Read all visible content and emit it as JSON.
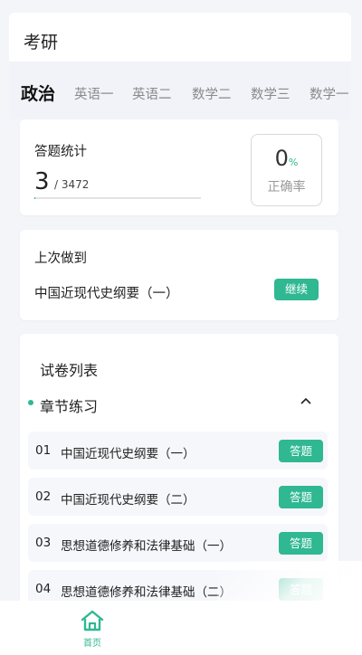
{
  "header": {
    "title": "考研"
  },
  "tabs": [
    {
      "label": "政治",
      "active": true
    },
    {
      "label": "英语一"
    },
    {
      "label": "英语二"
    },
    {
      "label": "数学二"
    },
    {
      "label": "数学三"
    },
    {
      "label": "数学一"
    }
  ],
  "stats": {
    "label": "答题统计",
    "answered": "3",
    "total": "/ 3472",
    "progress_fraction": 0.0009,
    "correct_rate": "0",
    "correct_rate_unit": "%",
    "correct_rate_label": "正确率"
  },
  "last_done": {
    "label": "上次做到",
    "chapter": "中国近现代史纲要（一）",
    "continue_label": "继续"
  },
  "paper_list": {
    "title": "试卷列表",
    "section_label": "章节练习",
    "items": [
      {
        "num": "01",
        "name": "中国近现代史纲要（一）",
        "action": "答题"
      },
      {
        "num": "02",
        "name": "中国近现代史纲要（二）",
        "action": "答题"
      },
      {
        "num": "03",
        "name": "思想道德修养和法律基础（一）",
        "action": "答题"
      },
      {
        "num": "04",
        "name": "思想道德修养和法律基础（二）",
        "action": "答题"
      }
    ]
  },
  "bottom_nav": {
    "home_label": "首页"
  },
  "colors": {
    "accent": "#2fb892",
    "icon": "home-icon"
  }
}
